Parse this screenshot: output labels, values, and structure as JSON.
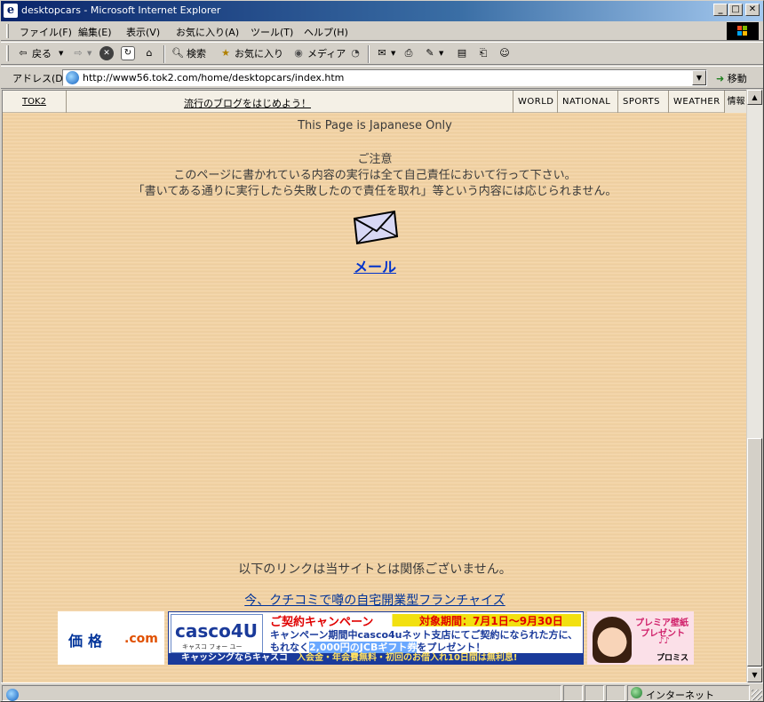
{
  "window": {
    "title": "desktopcars - Microsoft Internet Explorer",
    "minimize": "_",
    "maximize": "□",
    "close": "✕"
  },
  "menu": {
    "items": [
      "ファイル(F)",
      "編集(E)",
      "表示(V)",
      "お気に入り(A)",
      "ツール(T)",
      "ヘルプ(H)"
    ]
  },
  "toolbar": {
    "back": "戻る",
    "search": "検索",
    "favorites": "お気に入り",
    "media": "メディア"
  },
  "address": {
    "label": "アドレス(D)",
    "url": "http://www56.tok2.com/home/desktopcars/index.htm",
    "go": "移動"
  },
  "sitebar": {
    "tok2": "TOK2",
    "promo": "流行のブログをはじめよう！",
    "nav": [
      "WORLD",
      "NATIONAL",
      "SPORTS",
      "WEATHER"
    ],
    "info": "情報"
  },
  "content": {
    "japanese_only": "This  Page is Japanese Only",
    "notice_title": "ご注意",
    "notice_line1": "このページに書かれている内容の実行は全て自己責任において行って下さい。",
    "notice_line2": "「書いてある通りに実行したら失敗したので責任を取れ」等という内容には応じられません。",
    "mail_link": "メール",
    "disclaimer": "以下のリンクは当サイトとは関係ございません。",
    "franchise_link": "今、クチコミで噂の自宅開業型フランチャイズ"
  },
  "ads": {
    "kakaku": {
      "name": "価格",
      "suffix": ".com"
    },
    "casco": {
      "logo": "casco4U",
      "logo_sub": "キャスコ フォー ユー",
      "head1": "ご契約キャンペーン",
      "head2": "対象期間：7月1日〜9月30日",
      "line1": "キャンペーン期間中casco4uネット支店にてご契約になられた方に、",
      "line2_a": "もれなく",
      "line2_highlight": "2,000円のJCBギフト券",
      "line2_b": "をプレゼント！",
      "foot_a": "キャッシングならキャスコ",
      "foot_b": "入会金・年会費無料・初回のお借入れ10日間は無利息!"
    },
    "promise": {
      "t1": "プレミア壁紙",
      "t2": "プレゼント",
      "t3": "♪♪",
      "brand": "プロミス"
    }
  },
  "status": {
    "zone": "インターネット"
  },
  "colors": {
    "page_background": "#f3d3a4",
    "link": "#0033cc",
    "titlebar": "#0a246a"
  }
}
